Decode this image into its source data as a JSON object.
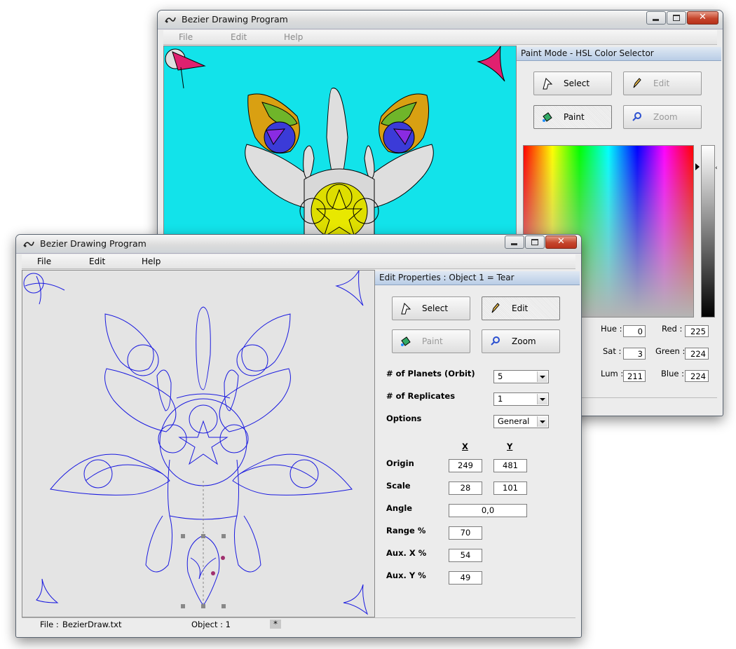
{
  "back_window": {
    "title": "Bezier Drawing Program",
    "menu": [
      "File",
      "Edit",
      "Help"
    ],
    "panel_title": "Paint Mode - HSL Color Selector",
    "buttons": {
      "select": "Select",
      "edit": "Edit",
      "paint": "Paint",
      "zoom": "Zoom"
    },
    "hsl": {
      "hue_label": "Hue :",
      "hue": "0",
      "sat_label": "Sat :",
      "sat": "3",
      "lum_label": "Lum :",
      "lum": "211",
      "red_label": "Red :",
      "red": "225",
      "green_label": "Green :",
      "green": "224",
      "blue_label": "Blue :",
      "blue": "224"
    },
    "canvas_color": "#12e3ea"
  },
  "front_window": {
    "title": "Bezier Drawing Program",
    "menu": [
      "File",
      "Edit",
      "Help"
    ],
    "panel_title": "Edit Properties : Object 1 = Tear",
    "buttons": {
      "select": "Select",
      "edit": "Edit",
      "paint": "Paint",
      "zoom": "Zoom"
    },
    "props": {
      "planets_label": "# of Planets (Orbit)",
      "planets_value": "5",
      "replicates_label": "# of Replicates",
      "replicates_value": "1",
      "options_label": "Options",
      "options_value": "General",
      "x_header": "X",
      "y_header": "Y",
      "origin_label": "Origin",
      "origin_x": "249",
      "origin_y": "481",
      "scale_label": "Scale",
      "scale_x": "28",
      "scale_y": "101",
      "angle_label": "Angle",
      "angle_value": "0,0",
      "range_label": "Range %",
      "range_value": "70",
      "auxx_label": "Aux. X %",
      "auxx_value": "54",
      "auxy_label": "Aux. Y %",
      "auxy_value": "49"
    },
    "status": {
      "file_label": "File :",
      "file_name": "BezierDraw.txt",
      "object": "Object : 1",
      "marker": "*"
    }
  }
}
